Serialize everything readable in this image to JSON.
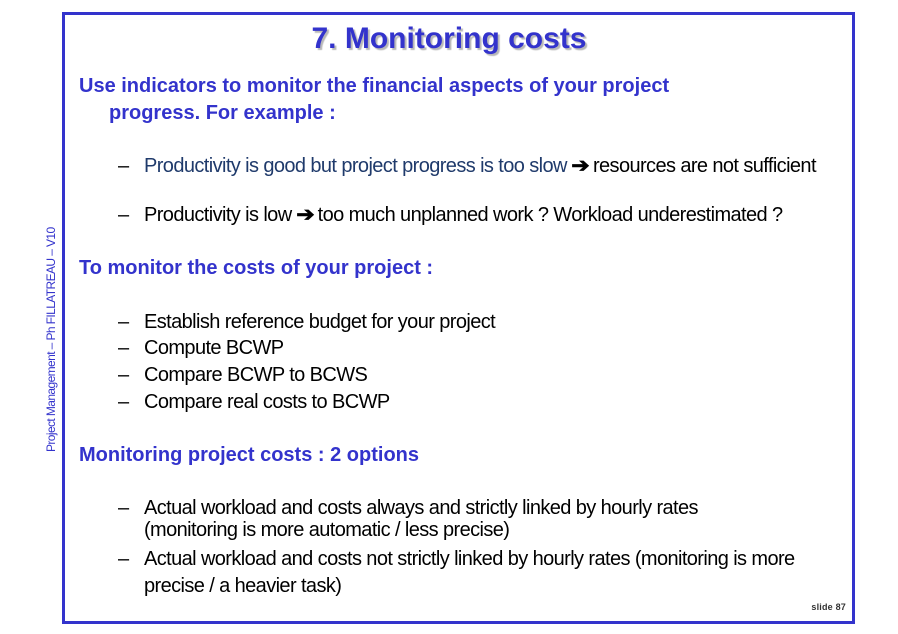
{
  "side_label": "Project Management – Ph FILLATREAU – V10",
  "title": "7. Monitoring costs",
  "intro": {
    "line1": "Use indicators  to monitor the financial aspects of your project",
    "line2": "progress.  For example :"
  },
  "bullets1": [
    {
      "part1": "Productivity is good but project progress is too slow ",
      "arrow": "➔",
      "part2": " resources are not sufficient"
    },
    {
      "part1": "Productivity is low ",
      "arrow": "➔",
      "part2": " too much unplanned work ? Workload underestimated ?"
    }
  ],
  "heading2": "To monitor the costs of your project :",
  "bullets2": [
    "Establish reference budget for your project",
    "Compute BCWP",
    "Compare BCWP to BCWS",
    "Compare real costs to BCWP"
  ],
  "heading3": "Monitoring project costs : 2 options",
  "bullets3": [
    "Actual workload and costs always and strictly linked by hourly rates (monitoring is more automatic / less precise)",
    "Actual workload and costs not strictly linked by hourly rates (monitoring is more precise / a heavier task)"
  ],
  "dash": "–",
  "slide_number": "slide 87"
}
